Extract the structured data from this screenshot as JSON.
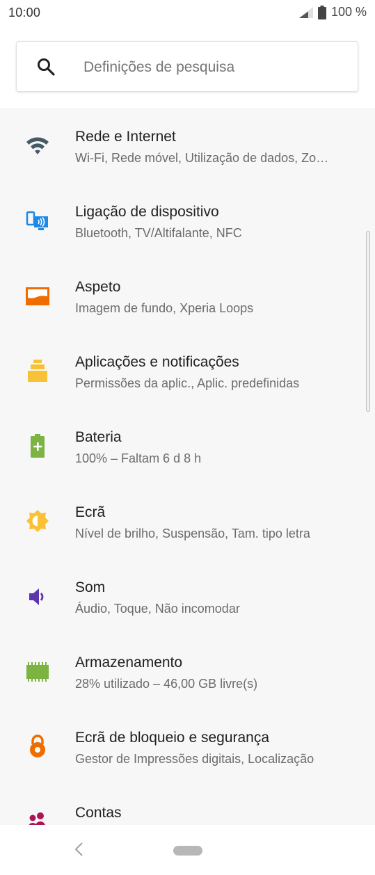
{
  "status_bar": {
    "time": "10:00",
    "battery_text": "100 %",
    "signal_icon": "cellular-signal-icon",
    "battery_icon": "battery-full-icon"
  },
  "search": {
    "placeholder": "Definições de pesquisa",
    "icon": "search-icon"
  },
  "settings_items": [
    {
      "title": "Rede e Internet",
      "subtitle": "Wi-Fi, Rede móvel, Utilização de dados, Zo…",
      "icon": "wifi-icon",
      "color": "#455a64"
    },
    {
      "title": "Ligação de dispositivo",
      "subtitle": "Bluetooth, TV/Altifalante, NFC",
      "icon": "device-connection-icon",
      "color": "#1e88e5"
    },
    {
      "title": "Aspeto",
      "subtitle": "Imagem de fundo, Xperia Loops",
      "icon": "wallpaper-icon",
      "color": "#ef6c00"
    },
    {
      "title": "Aplicações e notificações",
      "subtitle": "Permissões da aplic., Aplic. predefinidas",
      "icon": "apps-icon",
      "color": "#f9c236"
    },
    {
      "title": "Bateria",
      "subtitle": "100% – Faltam 6 d 8 h",
      "icon": "battery-icon",
      "color": "#7cb342"
    },
    {
      "title": "Ecrã",
      "subtitle": "Nível de brilho, Suspensão, Tam. tipo letra",
      "icon": "brightness-icon",
      "color": "#f9c236"
    },
    {
      "title": "Som",
      "subtitle": "Áudio, Toque, Não incomodar",
      "icon": "volume-icon",
      "color": "#5e35b1"
    },
    {
      "title": "Armazenamento",
      "subtitle": "28% utilizado – 46,00 GB livre(s)",
      "icon": "storage-icon",
      "color": "#7cb342"
    },
    {
      "title": "Ecrã de bloqueio e segurança",
      "subtitle": "Gestor de Impressões digitais, Localização",
      "icon": "lock-icon",
      "color": "#ef6c00"
    },
    {
      "title": "Contas",
      "subtitle": "",
      "icon": "accounts-icon",
      "color": "#ad1457"
    }
  ],
  "nav_bar": {
    "back_icon": "back-icon",
    "home_icon": "home-pill-icon"
  }
}
